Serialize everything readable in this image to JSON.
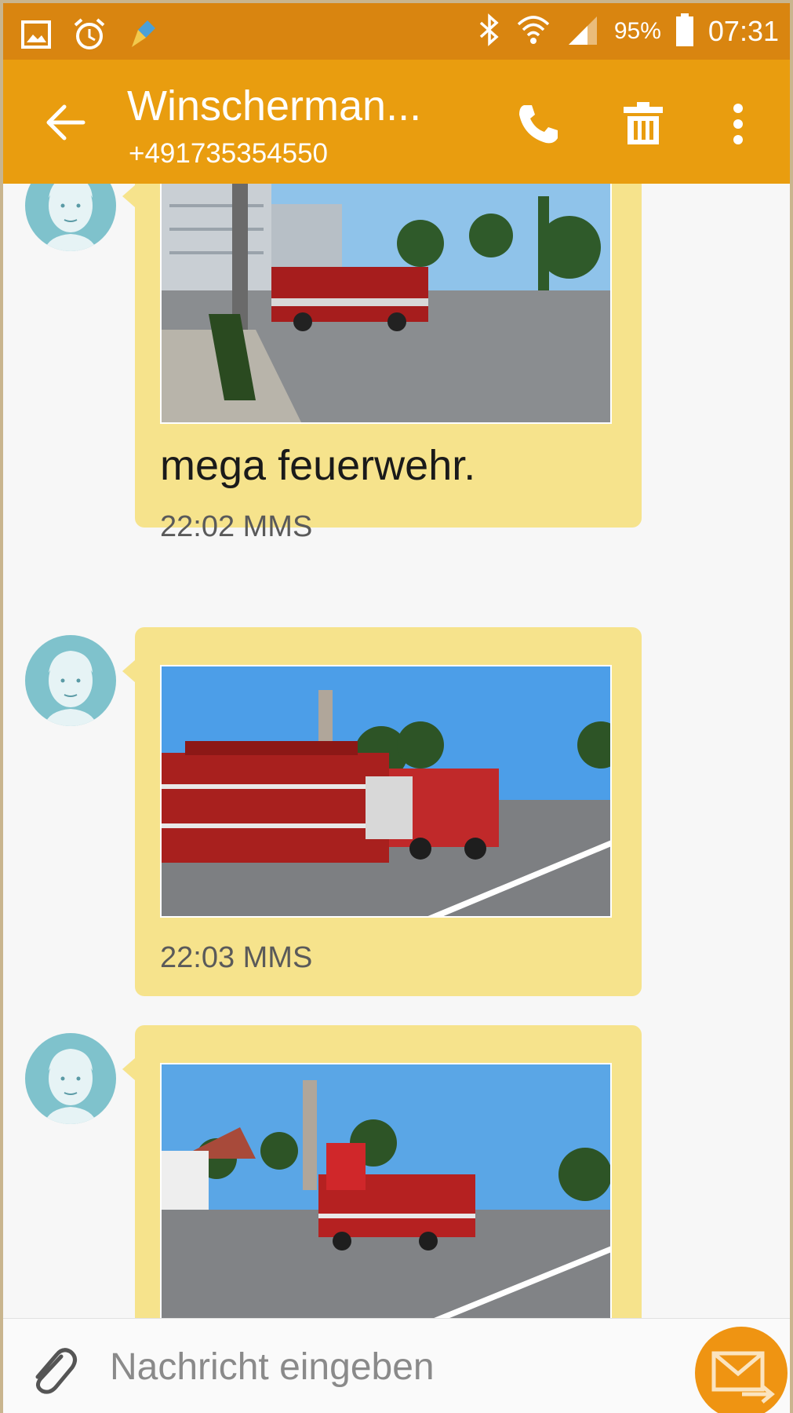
{
  "status_bar": {
    "left_icons": [
      "gallery-icon",
      "alarm-icon",
      "cleaner-icon"
    ],
    "right_icons": [
      "bluetooth-icon",
      "wifi-icon",
      "signal-icon",
      "battery-icon"
    ],
    "battery": "95%",
    "time": "07:31"
  },
  "toolbar": {
    "title": "Winscherman...",
    "subtitle": "+491735354550",
    "icons": [
      "back-arrow-icon",
      "phone-icon",
      "trash-icon",
      "more-vert-icon"
    ]
  },
  "messages": [
    {
      "text": "mega feuerwehr.",
      "time": "22:02",
      "type": "MMS",
      "meta": "22:02 MMS"
    },
    {
      "text": "",
      "time": "22:03",
      "type": "MMS",
      "meta": "22:03 MMS"
    },
    {
      "text": "",
      "time": "",
      "type": "",
      "meta": ""
    }
  ],
  "composer": {
    "placeholder": "Nachricht eingeben",
    "value": ""
  },
  "colors": {
    "status_bar": "#d98510",
    "toolbar": "#e99d0f",
    "bubble": "#f6e38c",
    "avatar": "#7fc2cc",
    "send_button": "#ef9412"
  }
}
